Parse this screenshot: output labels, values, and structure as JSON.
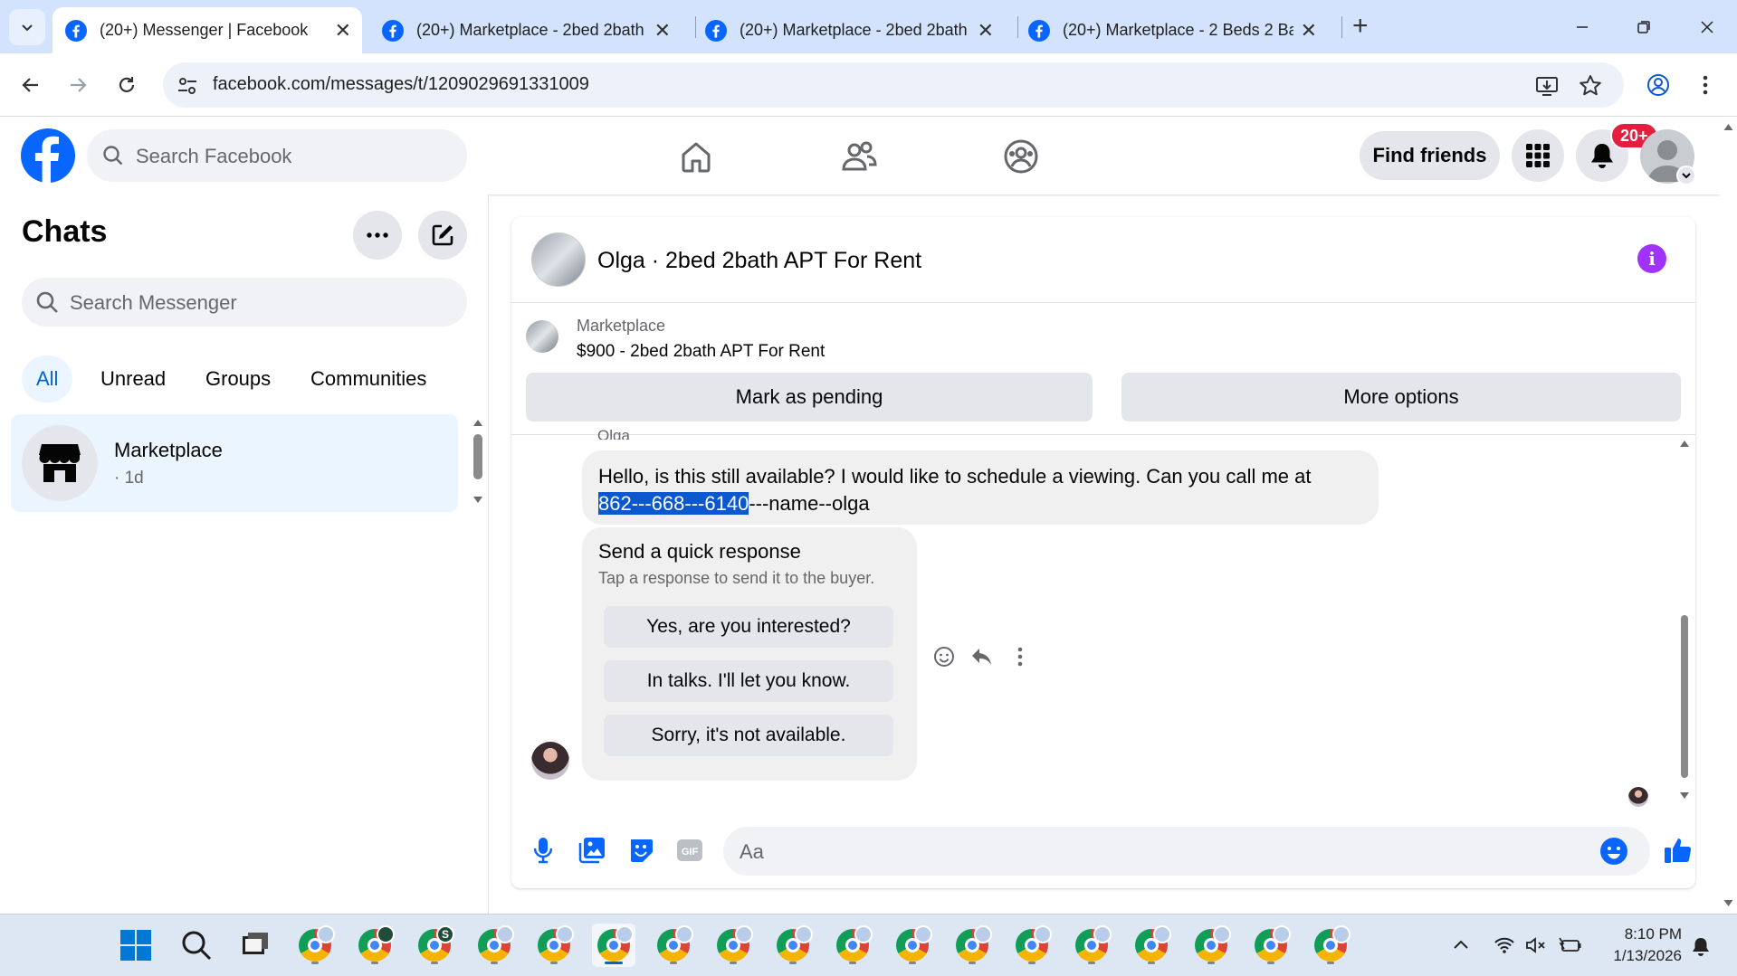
{
  "browser": {
    "tabs": [
      {
        "title": "(20+) Messenger | Facebook",
        "active": true
      },
      {
        "title": "(20+) Marketplace - 2bed 2bath",
        "active": false
      },
      {
        "title": "(20+) Marketplace - 2bed 2bath",
        "active": false
      },
      {
        "title": "(20+) Marketplace - 2 Beds 2 Ba",
        "active": false
      }
    ],
    "url": "facebook.com/messages/t/1209029691331009"
  },
  "facebook": {
    "search_placeholder": "Search Facebook",
    "find_friends": "Find friends",
    "notification_count": "20+"
  },
  "sidebar": {
    "title": "Chats",
    "search_placeholder": "Search Messenger",
    "filters": [
      "All",
      "Unread",
      "Groups",
      "Communities"
    ],
    "active_filter": "All",
    "conversations": [
      {
        "name": "Marketplace",
        "time": "· 1d"
      }
    ]
  },
  "chat": {
    "title": "Olga · 2bed 2bath APT For Rent",
    "listing": {
      "source": "Marketplace",
      "price_title": "$900 - 2bed 2bath APT For Rent"
    },
    "actions": {
      "mark_pending": "Mark as pending",
      "more_options": "More options"
    },
    "sender_name": "Olga",
    "message": {
      "text_line1": "Hello, is this still available? I would like to schedule a viewing. Can you call me at",
      "phone_selected": "862---668---6140",
      "text_rest": "---name--olga"
    },
    "quick_response": {
      "title": "Send a quick response",
      "subtitle": "Tap a response to send it to the buyer.",
      "options": [
        "Yes, are you interested?",
        "In talks. I'll let you know.",
        "Sorry, it's not available."
      ]
    },
    "composer_placeholder": "Aa"
  },
  "taskbar": {
    "time": "8:10 PM",
    "date": "1/13/2026"
  },
  "colors": {
    "facebook_blue": "#0866ff",
    "tab_strip": "#d3e3fd",
    "selection": "#0b57d0",
    "notification_red": "#e41e3f",
    "info_purple": "#a033ff"
  }
}
